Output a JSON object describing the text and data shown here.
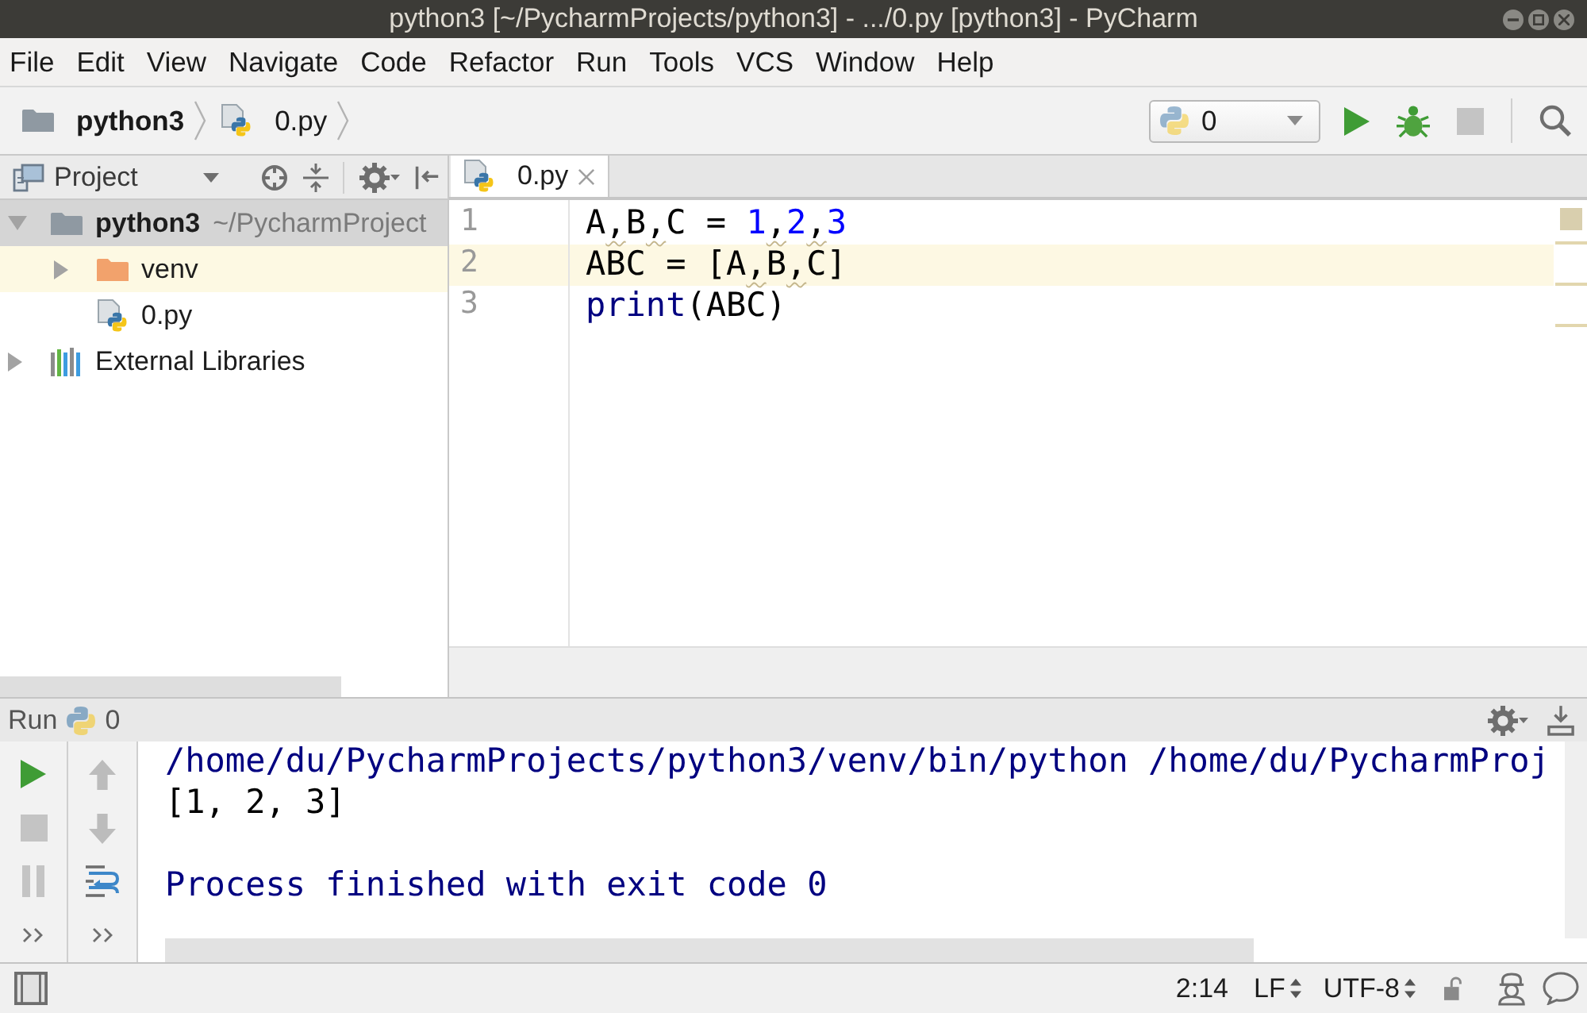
{
  "window": {
    "title": "python3 [~/PycharmProjects/python3] - .../0.py [python3] - PyCharm"
  },
  "menu": [
    "File",
    "Edit",
    "View",
    "Navigate",
    "Code",
    "Refactor",
    "Run",
    "Tools",
    "VCS",
    "Window",
    "Help"
  ],
  "navbar": {
    "breadcrumbs": [
      {
        "label": "python3",
        "kind": "project"
      },
      {
        "label": "0.py",
        "kind": "python-file"
      }
    ],
    "run_config": "0",
    "actions": [
      {
        "kind": "run",
        "disabled": false
      },
      {
        "kind": "debug",
        "disabled": false
      },
      {
        "kind": "stop",
        "disabled": true
      },
      {
        "kind": "search",
        "disabled": false
      }
    ]
  },
  "project": {
    "title": "Project",
    "tree": [
      {
        "label": "python3",
        "path": "~/PycharmProject",
        "kind": "project",
        "expanded": true,
        "selected": true,
        "highlighted": false,
        "children": [
          {
            "label": "venv",
            "kind": "excluded-folder",
            "expanded": false,
            "selected": false,
            "highlighted": true
          },
          {
            "label": "0.py",
            "kind": "python-file",
            "selected": false,
            "highlighted": false
          }
        ]
      },
      {
        "label": "External Libraries",
        "kind": "libraries",
        "expanded": false,
        "selected": false,
        "highlighted": false
      }
    ]
  },
  "editor": {
    "tabs": [
      {
        "label": "0.py",
        "selected": true
      }
    ],
    "lines": [
      {
        "number": "1",
        "current": false,
        "marked": true,
        "tokens": [
          {
            "kind": "plain",
            "text": "A"
          },
          {
            "kind": "warning",
            "text": ","
          },
          {
            "kind": "plain",
            "text": "B"
          },
          {
            "kind": "warning",
            "text": ","
          },
          {
            "kind": "plain",
            "text": "C = "
          },
          {
            "kind": "number",
            "text": "1"
          },
          {
            "kind": "warning",
            "text": ","
          },
          {
            "kind": "number",
            "text": "2"
          },
          {
            "kind": "warning",
            "text": ","
          },
          {
            "kind": "number",
            "text": "3"
          }
        ]
      },
      {
        "number": "2",
        "current": true,
        "marked": true,
        "tokens": [
          {
            "kind": "plain",
            "text": "ABC = [A"
          },
          {
            "kind": "warning",
            "text": ","
          },
          {
            "kind": "plain",
            "text": "B"
          },
          {
            "kind": "warning",
            "text": ","
          },
          {
            "kind": "plain",
            "text": "C]"
          }
        ]
      },
      {
        "number": "3",
        "current": false,
        "marked": true,
        "tokens": [
          {
            "kind": "builtin",
            "text": "print"
          },
          {
            "kind": "plain",
            "text": "(ABC)"
          }
        ]
      }
    ]
  },
  "run": {
    "title": "Run",
    "config": "0",
    "left_toolbar": [
      {
        "kind": "rerun",
        "disabled": false
      },
      {
        "kind": "stop",
        "disabled": true
      },
      {
        "kind": "pause",
        "disabled": true
      },
      {
        "kind": "more",
        "disabled": false
      }
    ],
    "second_toolbar": [
      {
        "kind": "up",
        "disabled": true
      },
      {
        "kind": "down",
        "disabled": true
      },
      {
        "kind": "soft-wrap",
        "disabled": false
      },
      {
        "kind": "more",
        "disabled": false
      }
    ],
    "console": [
      {
        "kind": "command",
        "text": "/home/du/PycharmProjects/python3/venv/bin/python /home/du/PycharmProj"
      },
      {
        "kind": "output",
        "text": "[1, 2, 3]"
      },
      {
        "kind": "blank"
      },
      {
        "kind": "system",
        "text": "Process finished with exit code 0"
      }
    ]
  },
  "status_bar": {
    "position": "2:14",
    "line_separator": "LF",
    "encoding": "UTF-8"
  }
}
